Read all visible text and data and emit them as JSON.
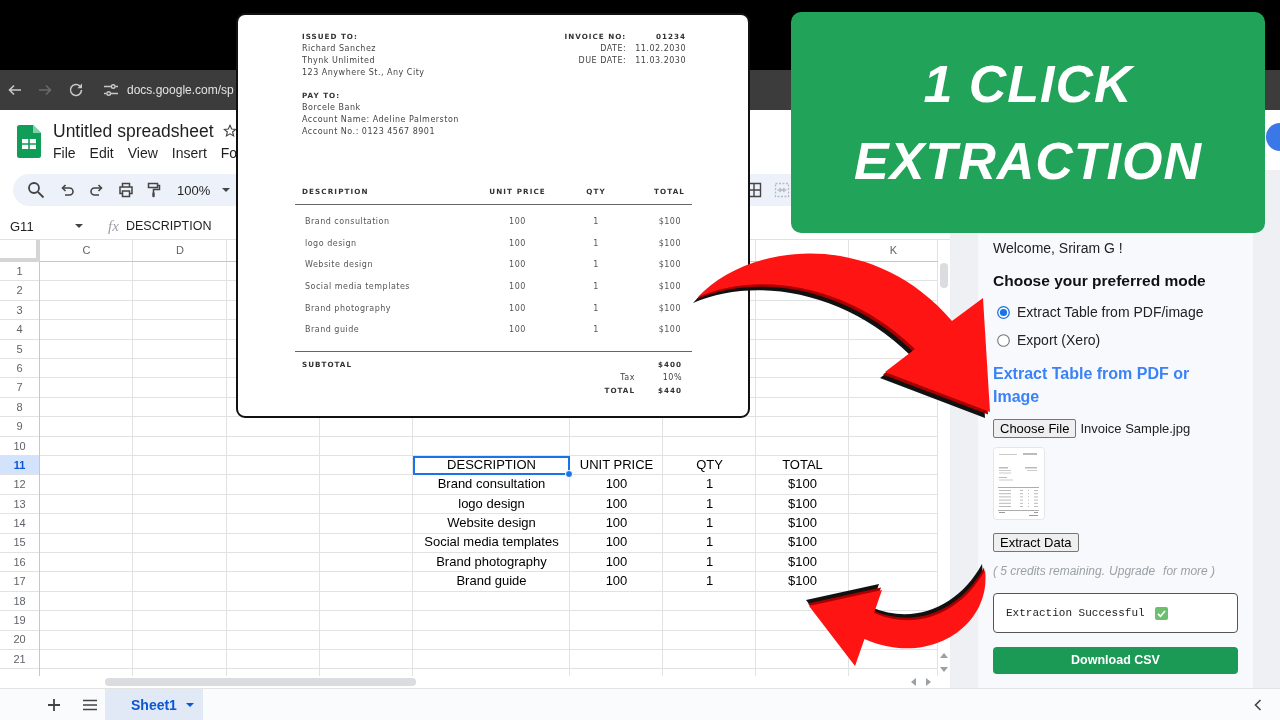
{
  "browser": {
    "url": "docs.google.com/sp",
    "forward_disabled": true
  },
  "sheets": {
    "title": "Untitled spreadsheet",
    "menu": [
      "File",
      "Edit",
      "View",
      "Insert",
      "Fo"
    ],
    "toolbar": {
      "zoom": "100%",
      "merge_disabled": true
    },
    "formula_bar": {
      "cell": "G11",
      "fx": "fx",
      "value": "DESCRIPTION"
    },
    "column_headers": [
      "C",
      "D",
      "K"
    ],
    "rows": [
      {
        "number": "1"
      },
      {
        "number": "2"
      },
      {
        "number": "3"
      },
      {
        "number": "4"
      },
      {
        "number": "5"
      },
      {
        "number": "6"
      },
      {
        "number": "7"
      },
      {
        "number": "8"
      },
      {
        "number": "9"
      },
      {
        "number": "10"
      },
      {
        "number": "11",
        "cells": [
          {
            "text": "DESCRIPTION",
            "selected": true
          },
          {
            "text": "UNIT PRICE",
            "selected": false
          },
          {
            "text": "QTY",
            "selected": false
          },
          {
            "text": "TOTAL",
            "selected": false
          }
        ]
      },
      {
        "number": "12",
        "cells": [
          {
            "text": "Brand consultation",
            "selected": false
          },
          {
            "text": "100",
            "selected": false
          },
          {
            "text": "1",
            "selected": false
          },
          {
            "text": "$100",
            "selected": false
          }
        ]
      },
      {
        "number": "13",
        "cells": [
          {
            "text": "logo design",
            "selected": false
          },
          {
            "text": "100",
            "selected": false
          },
          {
            "text": "1",
            "selected": false
          },
          {
            "text": "$100",
            "selected": false
          }
        ]
      },
      {
        "number": "14",
        "cells": [
          {
            "text": "Website design",
            "selected": false
          },
          {
            "text": "100",
            "selected": false
          },
          {
            "text": "1",
            "selected": false
          },
          {
            "text": "$100",
            "selected": false
          }
        ]
      },
      {
        "number": "15",
        "cells": [
          {
            "text": "Social media templates",
            "selected": false
          },
          {
            "text": "100",
            "selected": false
          },
          {
            "text": "1",
            "selected": false
          },
          {
            "text": "$100",
            "selected": false
          }
        ]
      },
      {
        "number": "16",
        "cells": [
          {
            "text": "Brand photography",
            "selected": false
          },
          {
            "text": "100",
            "selected": false
          },
          {
            "text": "1",
            "selected": false
          },
          {
            "text": "$100",
            "selected": false
          }
        ]
      },
      {
        "number": "17",
        "cells": [
          {
            "text": "Brand guide",
            "selected": false
          },
          {
            "text": "100",
            "selected": false
          },
          {
            "text": "1",
            "selected": false
          },
          {
            "text": "$100",
            "selected": false
          }
        ]
      },
      {
        "number": "18"
      },
      {
        "number": "19"
      },
      {
        "number": "20"
      },
      {
        "number": "21"
      }
    ],
    "sheet_tabs": [
      {
        "label": "Sheet1",
        "selected": true
      }
    ]
  },
  "invoice": {
    "issued_to": {
      "heading": "ISSUED TO:",
      "lines": [
        "Richard Sanchez",
        "Thynk Unlimited",
        "123 Anywhere St., Any City"
      ]
    },
    "pay_to": {
      "heading": "PAY TO:",
      "lines": [
        "Borcele Bank",
        "Account Name: Adeline Palmerston",
        "Account No.: 0123 4567 8901"
      ]
    },
    "meta": [
      {
        "kind": "number",
        "label": "INVOICE NO:",
        "value": "01234"
      },
      {
        "kind": "date",
        "label": "DATE:",
        "value": "11.02.2030"
      },
      {
        "kind": "date",
        "label": "DUE DATE:",
        "value": "11.03.2030"
      }
    ],
    "columns": [
      "DESCRIPTION",
      "UNIT PRICE",
      "QTY",
      "TOTAL"
    ],
    "items": [
      [
        "Brand consultation",
        "100",
        "1",
        "$100"
      ],
      [
        "logo design",
        "100",
        "1",
        "$100"
      ],
      [
        "Website design",
        "100",
        "1",
        "$100"
      ],
      [
        "Social media templates",
        "100",
        "1",
        "$100"
      ],
      [
        "Brand photography",
        "100",
        "1",
        "$100"
      ],
      [
        "Brand guide",
        "100",
        "1",
        "$100"
      ]
    ],
    "summary": [
      {
        "kind": "subtotal",
        "label": "SUBTOTAL",
        "value": "$400"
      },
      {
        "kind": "tax",
        "label": "Tax",
        "value": "10%"
      },
      {
        "kind": "total",
        "label": "TOTAL",
        "value": "$440"
      }
    ]
  },
  "banner": {
    "text": "1 CLICK EXTRACTION"
  },
  "panel": {
    "welcome": "Welcome, Sriram G !",
    "mode_heading": "Choose your preferred mode",
    "modes": [
      {
        "label": "Extract Table from PDF/image",
        "selected": true
      },
      {
        "label": "Export (Xero)",
        "selected": false
      }
    ],
    "section_title": "Extract Table from PDF or Image",
    "file_button": "Choose File",
    "file_name": "Invoice Sample.jpg",
    "extract_button": "Extract Data",
    "credits": {
      "before": "( 5 credits remaining.",
      "link": "Upgrade",
      "after": "for more )"
    },
    "status": "Extraction Successful",
    "download_button": "Download CSV"
  }
}
